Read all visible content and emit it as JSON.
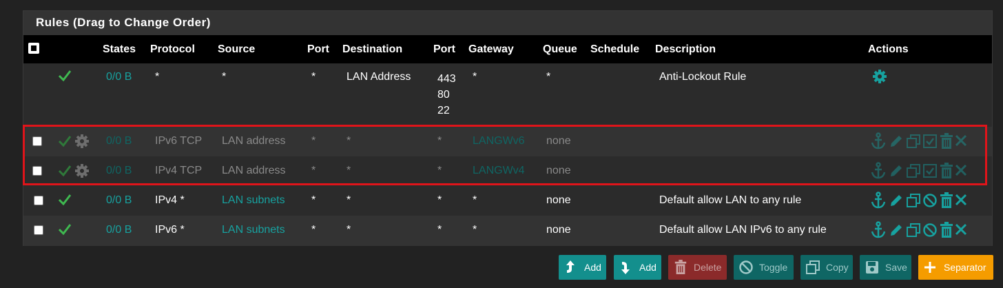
{
  "panel": {
    "title": "Rules (Drag to Change Order)"
  },
  "columns": [
    "States",
    "Protocol",
    "Source",
    "Port",
    "Destination",
    "Port",
    "Gateway",
    "Queue",
    "Schedule",
    "Description",
    "Actions"
  ],
  "rows": [
    {
      "states": "0/0 B",
      "protocol": "*",
      "source": "*",
      "port": "*",
      "destination": "LAN Address",
      "dport_lines": [
        "443",
        "80",
        "22"
      ],
      "gateway": "*",
      "queue": "*",
      "schedule": "",
      "description": "Anti-Lockout Rule"
    },
    {
      "states": "0/0 B",
      "protocol": "IPv6 TCP",
      "source": "LAN address",
      "port": "*",
      "destination": "*",
      "dport": "*",
      "gateway": "LANGWv6",
      "queue": "none",
      "schedule": "",
      "description": "",
      "disabled": true
    },
    {
      "states": "0/0 B",
      "protocol": "IPv4 TCP",
      "source": "LAN address",
      "port": "*",
      "destination": "*",
      "dport": "*",
      "gateway": "LANGWv4",
      "queue": "none",
      "schedule": "",
      "description": "",
      "disabled": true
    },
    {
      "states": "0/0 B",
      "protocol": "IPv4 *",
      "source": "LAN subnets",
      "port": "*",
      "destination": "*",
      "dport": "*",
      "gateway": "*",
      "queue": "none",
      "schedule": "",
      "description": "Default allow LAN to any rule"
    },
    {
      "states": "0/0 B",
      "protocol": "IPv6 *",
      "source": "LAN subnets",
      "port": "*",
      "destination": "*",
      "dport": "*",
      "gateway": "*",
      "queue": "none",
      "schedule": "",
      "description": "Default allow LAN IPv6 to any rule"
    }
  ],
  "buttons": {
    "add_top": "Add",
    "add_bottom": "Add",
    "delete": "Delete",
    "toggle": "Toggle",
    "copy": "Copy",
    "save": "Save",
    "separator": "Separator"
  },
  "colors": {
    "teal": "#17a2a0",
    "green": "#3fb950",
    "danger": "#8b2a2a",
    "warning": "#f59c00",
    "highlight": "#e0141a"
  },
  "icons": [
    "check-icon",
    "gear-icon",
    "anchor-icon",
    "pencil-icon",
    "copy-icon",
    "checkbox-icon",
    "ban-icon",
    "trash-icon",
    "times-icon",
    "arrow-up-icon",
    "arrow-down-icon",
    "save-icon",
    "plus-icon"
  ]
}
